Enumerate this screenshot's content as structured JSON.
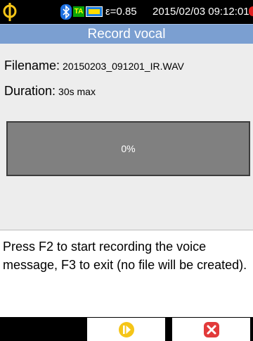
{
  "statusbar": {
    "logo_icon": "chauvin-arnoux-logo-icon",
    "bluetooth_icon": "bluetooth-icon",
    "ta_badge": "TA",
    "battery_icon": "battery-icon",
    "epsilon": "ε=0.85",
    "datetime": "2015/02/03 09:12:01",
    "recording_indicator_color": "#e02020"
  },
  "title": "Record vocal",
  "fields": {
    "filename_label": "Filename:",
    "filename_value": "20150203_091201_IR.WAV",
    "duration_label": "Duration:",
    "duration_value": "30s max"
  },
  "progress": {
    "percent_label": "0%",
    "value": 0
  },
  "message": "Press F2 to start recording the voice message, F3 to exit (no file will be created).",
  "softkeys": {
    "f2_icon": "start-record-icon",
    "f3_icon": "exit-icon",
    "f2_color": "#f5c518",
    "f3_color": "#e23a3a"
  },
  "colors": {
    "titlebar": "#7b9fd1",
    "progress_bg": "#808080"
  }
}
